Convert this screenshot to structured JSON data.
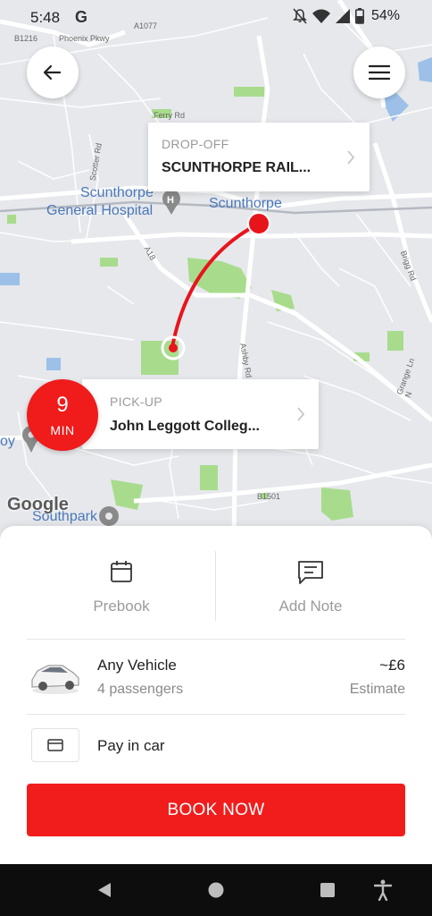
{
  "status_bar": {
    "time": "5:48",
    "carrier_icon": "G",
    "battery": "54%"
  },
  "map": {
    "labels": {
      "hospital_line1": "Scunthorpe",
      "hospital_line2": "General Hospital",
      "town": "Scunthorpe",
      "area": "Scunthorpe",
      "sou_park": "Southpark",
      "oy": "oy"
    },
    "road_labels": {
      "phoenix": "Phoenix Pkwy",
      "a1077": "A1077",
      "b1216": "B1216",
      "ferry": "Ferry Rd",
      "scotter": "Scotter Rd",
      "a18": "A18",
      "ashby": "Ashby Rd",
      "brigg": "Brigg Rd",
      "grange": "Grange Ln N",
      "b1501": "B1501"
    },
    "attribution": "Google",
    "route_color": "#e8141c"
  },
  "header": {
    "back_icon": "arrow-left-icon",
    "menu_icon": "hamburger-menu-icon"
  },
  "dropoff": {
    "caption": "DROP-OFF",
    "value": "SCUNTHORPE RAIL..."
  },
  "pickup": {
    "caption": "PICK-UP",
    "value": "John Leggott Colleg...",
    "eta_value": "9",
    "eta_unit": "MIN"
  },
  "actions": {
    "prebook": "Prebook",
    "add_note": "Add Note"
  },
  "vehicle": {
    "name": "Any Vehicle",
    "passengers": "4 passengers",
    "price": "~£6",
    "estimate": "Estimate"
  },
  "payment": {
    "label": "Pay in car"
  },
  "book_button": "BOOK NOW",
  "colors": {
    "accent": "#f11d1d",
    "map_bg": "#e6e8ec",
    "park": "#a8dc8c",
    "water": "#9cc0e8"
  }
}
